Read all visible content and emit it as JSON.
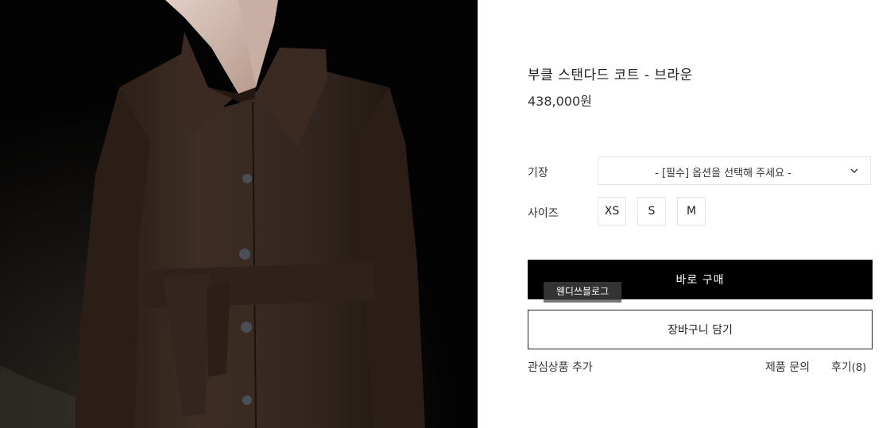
{
  "photo": {
    "alt_icon": "product-photo",
    "coat_color": "#3a2a22"
  },
  "product": {
    "name": "부클 스탠다드 코트 - 브라운",
    "price": "438,000원"
  },
  "options": {
    "length_label": "기장",
    "length_placeholder": "- [필수] 옵션을 선택해 주세요 -",
    "size_label": "사이즈",
    "sizes": [
      "XS",
      "S",
      "M"
    ]
  },
  "actions": {
    "buy_now": "바로 구매",
    "add_to_cart": "장바구니 담기",
    "wishlist": "관심상품 추가",
    "inquiry": "제품 문의",
    "review": "후기",
    "review_count": "(8)"
  },
  "watermark": "웬디쓰블로그",
  "colors": {
    "accent": "#000000",
    "border": "#e4e4e4"
  }
}
